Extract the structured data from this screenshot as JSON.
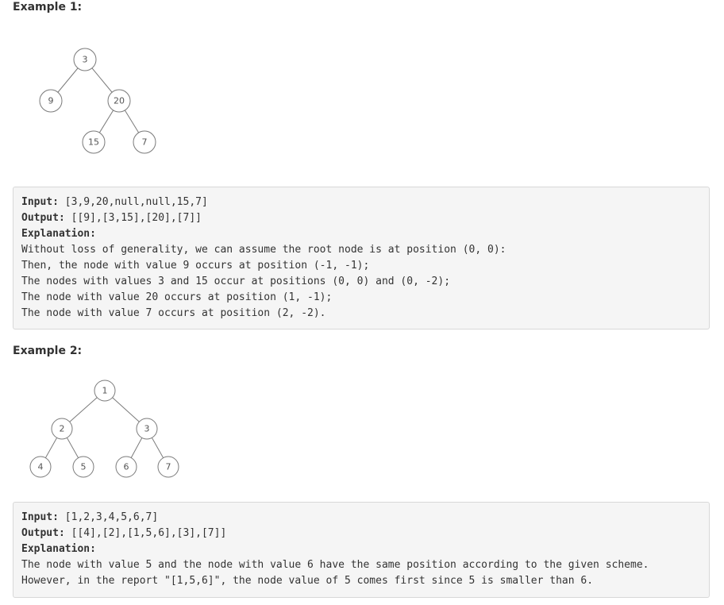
{
  "example1": {
    "heading": "Example 1:",
    "tree": {
      "nodes": [
        {
          "id": "n3",
          "label": "3"
        },
        {
          "id": "n9",
          "label": "9"
        },
        {
          "id": "n20",
          "label": "20"
        },
        {
          "id": "n15",
          "label": "15"
        },
        {
          "id": "n7",
          "label": "7"
        }
      ]
    },
    "input_label": "Input:",
    "input_value": " [3,9,20,null,null,15,7]",
    "output_label": "Output:",
    "output_value": " [[9],[3,15],[20],[7]]",
    "explanation_label": "Explanation:",
    "explanation_lines": [
      "Without loss of generality, we can assume the root node is at position (0, 0):",
      "Then, the node with value 9 occurs at position (-1, -1);",
      "The nodes with values 3 and 15 occur at positions (0, 0) and (0, -2);",
      "The node with value 20 occurs at position (1, -1);",
      "The node with value 7 occurs at position (2, -2)."
    ]
  },
  "example2": {
    "heading": "Example 2:",
    "tree": {
      "nodes": [
        {
          "id": "m1",
          "label": "1"
        },
        {
          "id": "m2",
          "label": "2"
        },
        {
          "id": "m3",
          "label": "3"
        },
        {
          "id": "m4",
          "label": "4"
        },
        {
          "id": "m5",
          "label": "5"
        },
        {
          "id": "m6",
          "label": "6"
        },
        {
          "id": "m7",
          "label": "7"
        }
      ]
    },
    "input_label": "Input:",
    "input_value": " [1,2,3,4,5,6,7]",
    "output_label": "Output:",
    "output_value": " [[4],[2],[1,5,6],[3],[7]]",
    "explanation_label": "Explanation:",
    "explanation_lines": [
      "The node with value 5 and the node with value 6 have the same position according to the given scheme.",
      "However, in the report \"[1,5,6]\", the node value of 5 comes first since 5 is smaller than 6."
    ]
  }
}
